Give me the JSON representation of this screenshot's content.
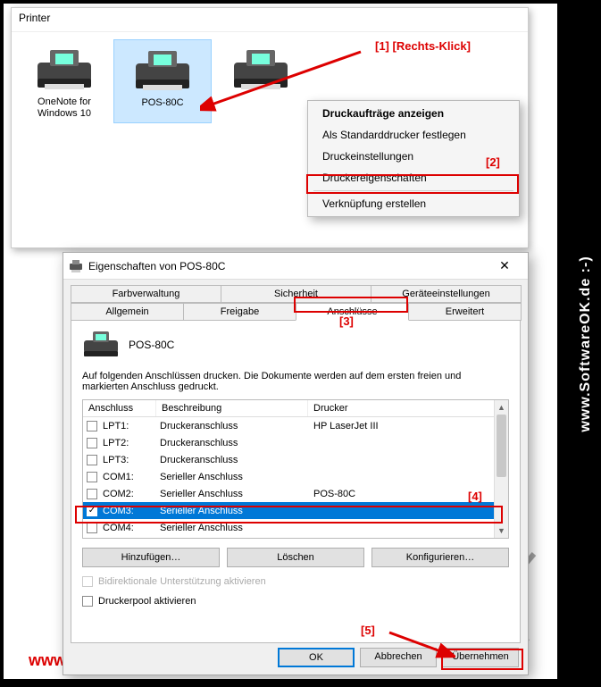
{
  "vertical_watermark": "www.SoftwareOK.de :-)",
  "bottom_watermark": "www.SoftwareOK.de :-)",
  "explorer": {
    "section": "Printer",
    "printers": [
      {
        "label": "OneNote for Windows 10"
      },
      {
        "label": "POS-80C"
      },
      {
        "label": ""
      }
    ]
  },
  "context_menu": {
    "items": [
      "Druckaufträge anzeigen",
      "Als Standarddrucker festlegen",
      "Druckeinstellungen",
      "Druckereigenschaften",
      "Verknüpfung erstellen"
    ]
  },
  "anno": {
    "a1": "[1]  [Rechts-Klick]",
    "a2": "[2]",
    "a3": "[3]",
    "a4": "[4]",
    "a5": "[5]"
  },
  "dialog": {
    "title": "Eigenschaften von POS-80C",
    "tabs_top": [
      "Farbverwaltung",
      "Sicherheit",
      "Geräteeinstellungen"
    ],
    "tabs_bottom": [
      "Allgemein",
      "Freigabe",
      "Anschlüsse",
      "Erweitert"
    ],
    "printer_name": "POS-80C",
    "desc": "Auf folgenden Anschlüssen drucken. Die Dokumente werden auf dem ersten freien und markierten Anschluss gedruckt.",
    "cols": {
      "port": "Anschluss",
      "desc": "Beschreibung",
      "printer": "Drucker"
    },
    "ports": [
      {
        "chk": false,
        "port": "LPT1:",
        "desc": "Druckeranschluss",
        "printer": "HP LaserJet III"
      },
      {
        "chk": false,
        "port": "LPT2:",
        "desc": "Druckeranschluss",
        "printer": ""
      },
      {
        "chk": false,
        "port": "LPT3:",
        "desc": "Druckeranschluss",
        "printer": ""
      },
      {
        "chk": false,
        "port": "COM1:",
        "desc": "Serieller Anschluss",
        "printer": ""
      },
      {
        "chk": false,
        "port": "COM2:",
        "desc": "Serieller Anschluss",
        "printer": "POS-80C"
      },
      {
        "chk": true,
        "port": "COM3:",
        "desc": "Serieller Anschluss",
        "printer": ""
      },
      {
        "chk": false,
        "port": "COM4:",
        "desc": "Serieller Anschluss",
        "printer": ""
      }
    ],
    "btn_add": "Hinzufügen…",
    "btn_del": "Löschen",
    "btn_cfg": "Konfigurieren…",
    "bidi": "Bidirektionale Unterstützung aktivieren",
    "pool": "Druckerpool aktivieren",
    "ok": "OK",
    "cancel": "Abbrechen",
    "apply": "Übernehmen"
  }
}
